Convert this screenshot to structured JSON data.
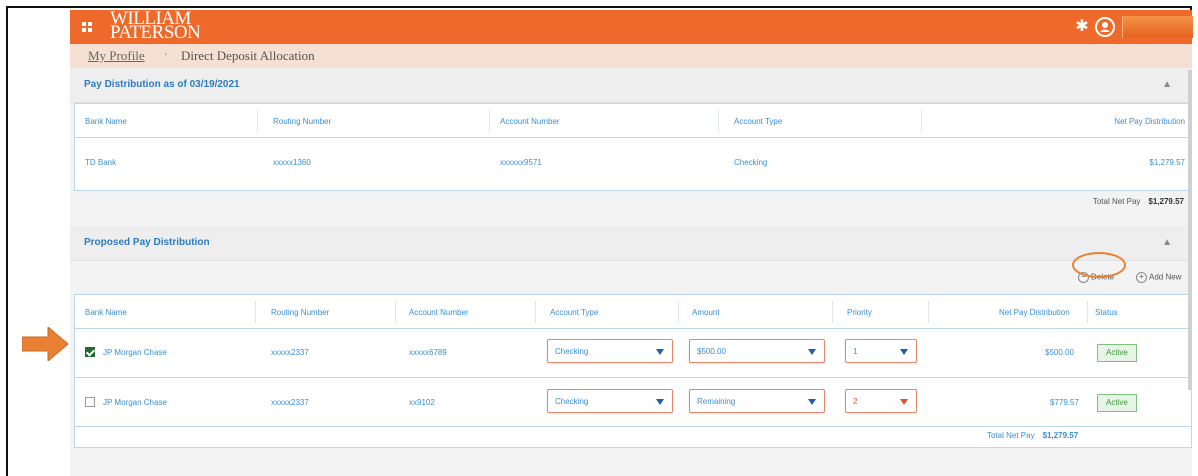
{
  "brand": {
    "line1": "WILLIAM",
    "line2": "PATERSON"
  },
  "breadcrumb": {
    "parent": "My Profile",
    "current": "Direct Deposit Allocation"
  },
  "current_distribution": {
    "title": "Pay Distribution as of 03/19/2021",
    "headers": [
      "Bank Name",
      "Routing Number",
      "Account Number",
      "Account Type",
      "Net Pay Distribution"
    ],
    "rows": [
      {
        "bank": "TD Bank",
        "routing": "xxxxx1360",
        "account": "xxxxxx9571",
        "type": "Checking",
        "net": "$1,279.57"
      }
    ],
    "total_label": "Total Net Pay",
    "total_value": "$1,279.57"
  },
  "proposed_distribution": {
    "title": "Proposed Pay Distribution",
    "delete_label": "Delete",
    "add_label": "Add New",
    "headers": [
      "Bank Name",
      "Routing Number",
      "Account Number",
      "Account Type",
      "Amount",
      "Priority",
      "Net Pay Distribution",
      "Status"
    ],
    "rows": [
      {
        "checked": true,
        "bank": "JP Morgan Chase",
        "routing": "xxxxx2337",
        "account": "xxxxx6789",
        "type": "Checking",
        "amount": "$500.00",
        "priority": "1",
        "net": "$500.00",
        "status": "Active"
      },
      {
        "checked": false,
        "bank": "JP Morgan Chase",
        "routing": "xxxxx2337",
        "account": "xx9102",
        "type": "Checking",
        "amount": "Remaining",
        "priority": "2",
        "net": "$779.57",
        "status": "Active"
      }
    ],
    "total_label": "Total Net Pay",
    "total_value": "$1,279.57"
  },
  "colors": {
    "brand_orange": "#ef6a2a",
    "link_blue": "#3a8fd4",
    "status_green": "#3c9a3c",
    "annotation_orange": "#e98034"
  }
}
